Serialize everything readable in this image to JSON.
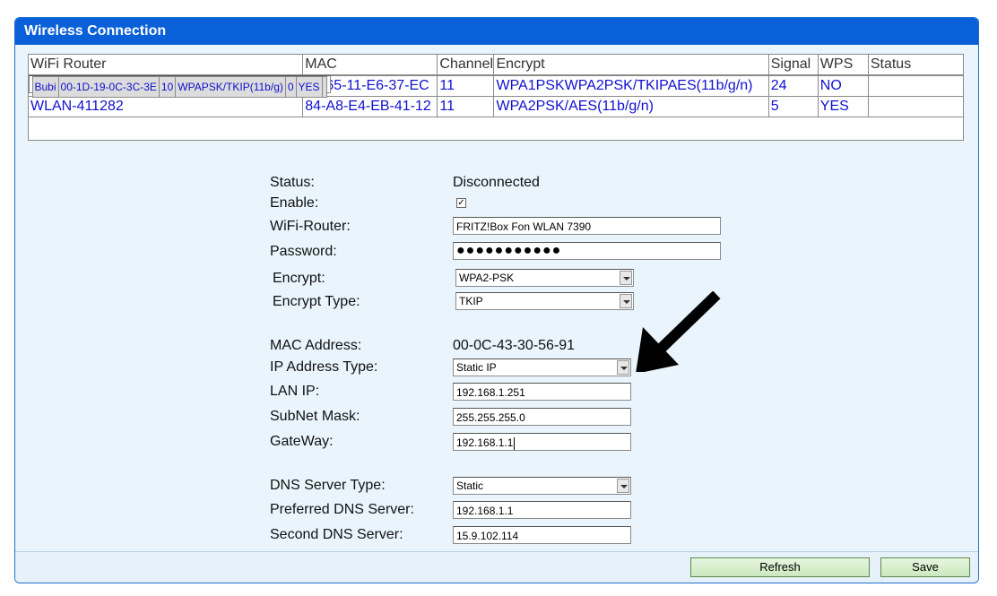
{
  "window": {
    "title": "Wireless Connection"
  },
  "table": {
    "headers": [
      "WiFi Router",
      "MAC",
      "Channel",
      "Encrypt",
      "Signal",
      "WPS",
      "Status"
    ],
    "rows": [
      [
        "Bubi",
        "00-1D-19-0C-3C-3E",
        "10",
        "WPAPSK/TKIP(11b/g)",
        "0",
        "YES",
        ""
      ],
      [
        "",
        "24-65-11-E6-37-EC",
        "11",
        "WPA1PSKWPA2PSK/TKIPAES(11b/g/n)",
        "24",
        "NO",
        ""
      ],
      [
        "WLAN-411282",
        "84-A8-E4-EB-41-12",
        "11",
        "WPA2PSK/AES(11b/g/n)",
        "5",
        "YES",
        ""
      ]
    ]
  },
  "form": {
    "status_label": "Status:",
    "status_value": "Disconnected",
    "enable_label": "Enable:",
    "enable_checked": "☑",
    "router_label": "WiFi-Router:",
    "router_value": "FRITZ!Box Fon WLAN 7390",
    "password_label": "Password:",
    "password_value": "●●●●●●●●●●●",
    "encrypt_label": "Encrypt:",
    "encrypt_value": "WPA2-PSK",
    "encrypt_type_label": "Encrypt Type:",
    "encrypt_type_value": "TKIP",
    "mac_label": "MAC Address:",
    "mac_value": "00-0C-43-30-56-91",
    "ip_type_label": "IP Address Type:",
    "ip_type_value": "Static IP",
    "lan_ip_label": "LAN IP:",
    "lan_ip_value": "192.168.1.251",
    "subnet_label": "SubNet Mask:",
    "subnet_value": "255.255.255.0",
    "gateway_label": "GateWay:",
    "gateway_value": "192.168.1.1",
    "dns_type_label": "DNS Server Type:",
    "dns_type_value": "Static",
    "pref_dns_label": "Preferred DNS Server:",
    "pref_dns_value": "192.168.1.1",
    "second_dns_label": "Second DNS Server:",
    "second_dns_value": "15.9.102.114"
  },
  "buttons": {
    "refresh": "Refresh",
    "save": "Save"
  },
  "colors": {
    "title_bar": "#0a60d8",
    "panel_bg": "#e9f4fc",
    "link_text": "#1010d0",
    "button_green": "#cbe8bf"
  },
  "icons": {
    "annotation_arrow": "arrow-pointing-left-down"
  }
}
